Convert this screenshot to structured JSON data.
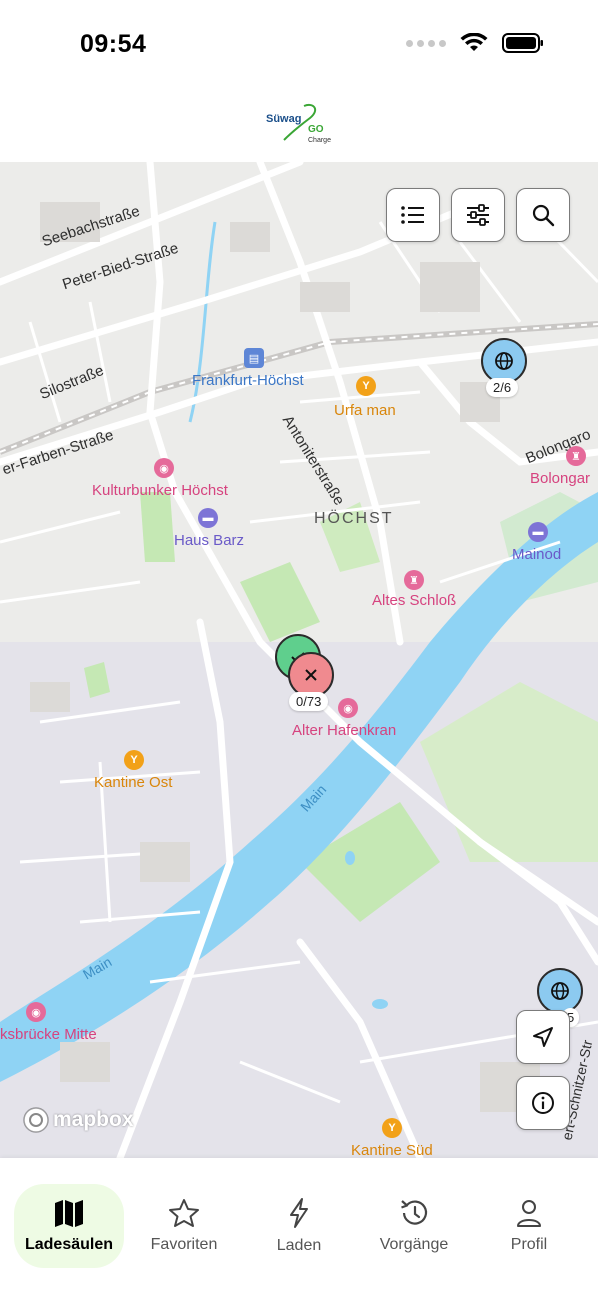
{
  "status_bar": {
    "time": "09:54"
  },
  "header": {
    "logo_brand": "Süwag",
    "logo_go": "GO",
    "logo_sub": "Charge"
  },
  "map": {
    "streets": {
      "seebach": "Seebachstraße",
      "peter_bied": "Peter-Bied-Straße",
      "silo": "Silostraße",
      "farben": "er-Farben-Straße",
      "antoniter": "Antoniterstraße",
      "bolongaro": "Bolongaro",
      "schnitzer": "ert-Schnitzer-Str"
    },
    "district": "HÖCHST",
    "water": {
      "main1": "Main",
      "main2": "Main"
    },
    "pois": {
      "station": "Frankfurt-Höchst",
      "urfa": "Urfa man",
      "kulturbunker": "Kulturbunker Höchst",
      "haus_barz": "Haus Barz",
      "bolongaro_poi": "Bolongar",
      "mainod": "Mainod",
      "altes_schloss": "Altes Schloß",
      "alter_hafenkran": "Alter Hafenkran",
      "kantine_ost": "Kantine Ost",
      "brucke_mitte": "ksbrücke Mitte",
      "kantine_sued": "Kantine Süd"
    },
    "markers": {
      "top_right_count": "2/6",
      "center_count": "0/73",
      "bottom_right_count": "5"
    },
    "attribution": "mapbox",
    "colors": {
      "water": "#8fd3f4",
      "park": "#c5e8b4",
      "marker_blue": "#8ccaf0",
      "marker_green": "#5fcf8d",
      "marker_red": "#f08a8f"
    }
  },
  "controls": {
    "list_icon": "list-icon",
    "filter_icon": "filter-icon",
    "search_icon": "search-icon",
    "locate_icon": "navigation-arrow-icon",
    "info_icon": "info-icon"
  },
  "bottom_nav": {
    "items": [
      {
        "label": "Ladesäulen",
        "icon": "map-icon",
        "active": true
      },
      {
        "label": "Favoriten",
        "icon": "star-icon",
        "active": false
      },
      {
        "label": "Laden",
        "icon": "lightning-icon",
        "active": false
      },
      {
        "label": "Vorgänge",
        "icon": "history-icon",
        "active": false
      },
      {
        "label": "Profil",
        "icon": "person-icon",
        "active": false
      }
    ]
  }
}
